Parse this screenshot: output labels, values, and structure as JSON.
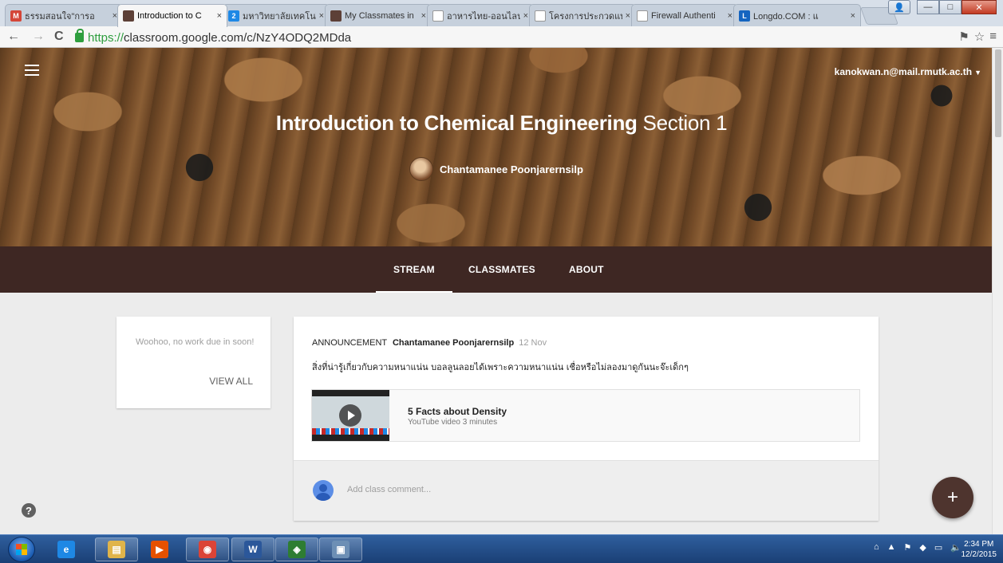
{
  "browser": {
    "tabs": [
      {
        "label": "ธรรมสอนใจ\"การอ",
        "favicon": "gmail-icon",
        "color": "#d44638",
        "glyph": "M",
        "active": false
      },
      {
        "label": "Introduction to C",
        "favicon": "classroom-icon",
        "color": "#5d4037",
        "glyph": "",
        "active": true
      },
      {
        "label": "มหาวิทยาลัยเทคโนโ",
        "favicon": "rmutk-icon",
        "color": "#1e88e5",
        "glyph": "2",
        "active": false
      },
      {
        "label": "My Classmates in",
        "favicon": "classroom-icon",
        "color": "#5d4037",
        "glyph": "",
        "active": false
      },
      {
        "label": "อาหารไทย-ออนไลน",
        "favicon": "page-icon",
        "color": "#ffffff",
        "glyph": "",
        "active": false
      },
      {
        "label": "โครงการประกวดแบ",
        "favicon": "page-icon",
        "color": "#ffffff",
        "glyph": "",
        "active": false
      },
      {
        "label": "Firewall Authenti",
        "favicon": "page-icon",
        "color": "#ffffff",
        "glyph": "",
        "active": false
      },
      {
        "label": "Longdo.COM : แ",
        "favicon": "longdo-icon",
        "color": "#1565c0",
        "glyph": "L",
        "active": false
      }
    ],
    "tab_close": "×",
    "window_buttons": {
      "minimize": "—",
      "maximize": "□",
      "close": "✕",
      "user": "👤"
    },
    "url_https": "https://",
    "url_rest": "classroom.google.com/c/NzY4ODQ2MDda",
    "nav": {
      "back": "←",
      "forward": "→",
      "reload": "C"
    },
    "toolbar_icons": {
      "translate": "⚑",
      "star": "☆",
      "menu": "≡"
    }
  },
  "classroom": {
    "account_email": "kanokwan.n@mail.rmutk.ac.th",
    "account_caret": "▼",
    "course_title": "Introduction to Chemical Engineering",
    "course_section": "Section 1",
    "teacher_name": "Chantamanee Poonjarernsilp",
    "tabs": [
      {
        "label": "STREAM",
        "active": true
      },
      {
        "label": "CLASSMATES",
        "active": false
      },
      {
        "label": "ABOUT",
        "active": false
      }
    ],
    "upcoming": {
      "message": "Woohoo, no work due in soon!",
      "view_all": "VIEW ALL"
    },
    "post": {
      "type_label": "ANNOUNCEMENT",
      "author": "Chantamanee Poonjarernsilp",
      "date": "12 Nov",
      "body": "สิ่งที่น่ารู้เกี่ยวกับความหนาแน่น บอลลูนลอยได้เพราะความหนาแน่น เชื่อหรือไม่ลองมาดูกันนะจ๊ะเด็กๆ",
      "attachment_title": "5 Facts about Density",
      "attachment_meta": "YouTube video  3 minutes",
      "comment_placeholder": "Add class comment..."
    },
    "help_glyph": "?",
    "fab_glyph": "+"
  },
  "taskbar": {
    "apps": [
      {
        "name": "internet-explorer-icon",
        "glyph": "e",
        "color": "#1e88e5",
        "pinned": false
      },
      {
        "name": "file-explorer-icon",
        "glyph": "▤",
        "color": "#e0b44a",
        "pinned": true
      },
      {
        "name": "media-player-icon",
        "glyph": "▶",
        "color": "#e65100",
        "pinned": false
      },
      {
        "name": "chrome-icon",
        "glyph": "◉",
        "color": "#db4437",
        "pinned": true
      },
      {
        "name": "word-icon",
        "glyph": "W",
        "color": "#2b579a",
        "pinned": true
      },
      {
        "name": "network-app-icon",
        "glyph": "◈",
        "color": "#2e7d32",
        "pinned": true
      },
      {
        "name": "photo-viewer-icon",
        "glyph": "▣",
        "color": "#6d8fb5",
        "pinned": true
      }
    ],
    "tray_icons": [
      "⌂",
      "▲",
      "⚑",
      "◆",
      "▭",
      "🔈"
    ],
    "time": "2:34 PM",
    "date": "12/2/2015"
  }
}
